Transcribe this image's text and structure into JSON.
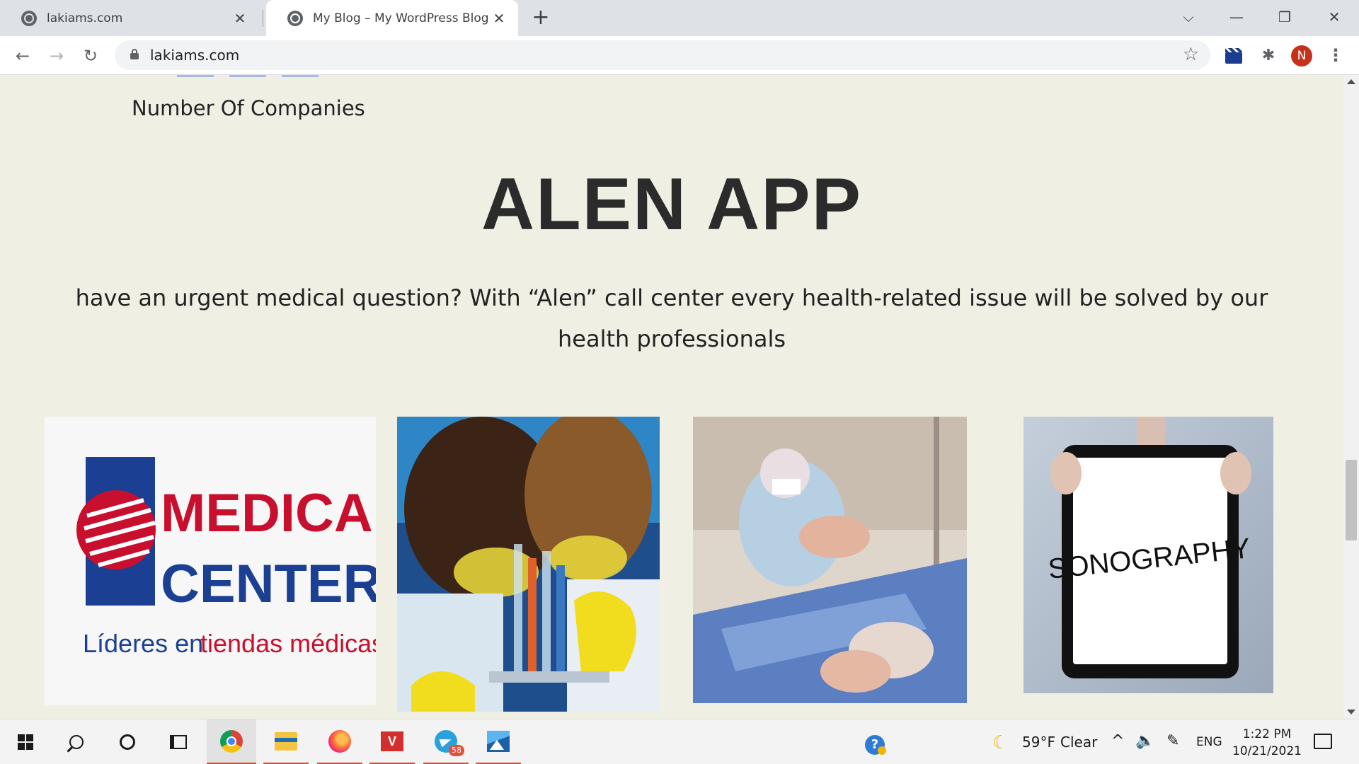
{
  "browser": {
    "tabs": [
      {
        "title": "lakiams.com",
        "active": false
      },
      {
        "title": "My Blog – My WordPress Blog",
        "active": true
      }
    ],
    "tab_close_glyph": "✕",
    "new_tab_glyph": "+",
    "window_controls": {
      "dropdown": "⌵",
      "minimize": "—",
      "restore": "❐",
      "close": "✕"
    },
    "nav": {
      "back": "←",
      "forward": "→",
      "reload": "↻"
    },
    "url": "lakiams.com",
    "bookmark_star": "☆",
    "extensions_glyph": "✱",
    "profile_initial": "N",
    "menu_glyph": "⋮"
  },
  "page": {
    "counter_label": "Number Of Companies",
    "hero_title": "ALEN APP",
    "hero_text": "have an urgent medical question? With “Alen” call center every health-related issue will be solved by our health professionals",
    "cards": [
      {
        "kind": "logo",
        "brand_line1": "MEDICAL",
        "brand_line2": "CENTER",
        "tagline_part1": "Líderes en",
        "tagline_part2": "tiendas médicas"
      },
      {
        "kind": "photo",
        "subject": "lab-scientists-photo"
      },
      {
        "kind": "photo",
        "subject": "newborn-delivery-photo"
      },
      {
        "kind": "photo",
        "subject": "sonography-tablet-photo",
        "tablet_text": "SONOGRAPHY"
      }
    ]
  },
  "taskbar": {
    "apps": [
      "start",
      "search",
      "cortana",
      "task-view",
      "chrome",
      "file-explorer",
      "firefox",
      "vt",
      "telegram",
      "photos"
    ],
    "vt_label": "V",
    "telegram_badge": "58",
    "help_glyph": "?",
    "weather_icon": "☾",
    "weather_temp": "59°F",
    "weather_cond": "Clear",
    "tray_chevron": "^",
    "volume_glyph": "🔈",
    "pen_glyph": "✎",
    "language": "ENG",
    "time": "1:22 PM",
    "date": "10/21/2021"
  },
  "colors": {
    "page_bg": "#f0efe4",
    "medical_red": "#c8102e",
    "medical_blue": "#1b3f93",
    "profile_red": "#c5321b"
  }
}
